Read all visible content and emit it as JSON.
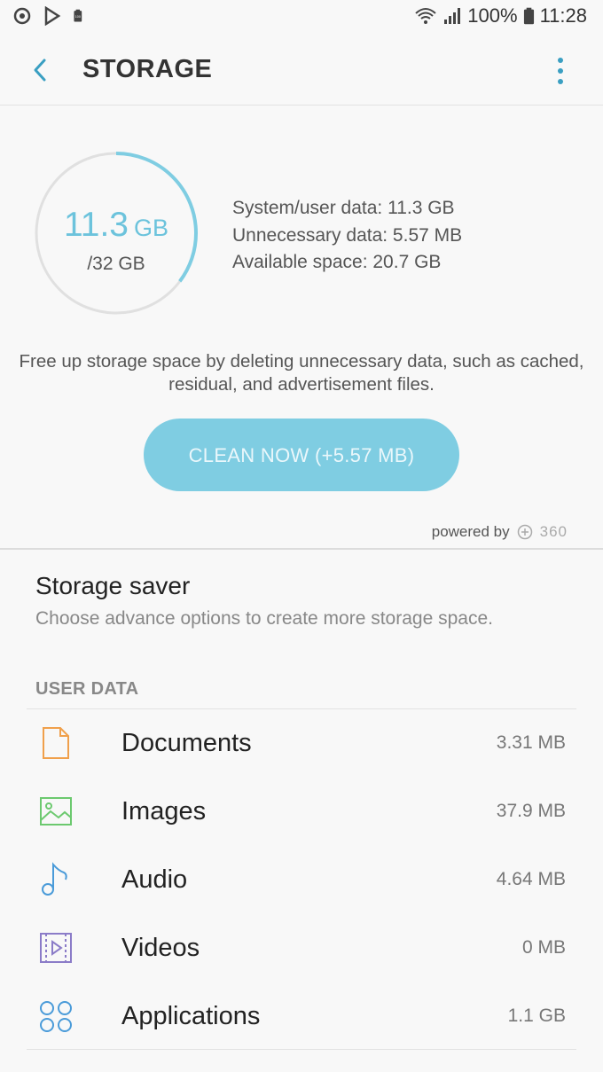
{
  "status_bar": {
    "battery_percent": "100%",
    "time": "11:28",
    "battery_icon_text": "100"
  },
  "header": {
    "title": "STORAGE"
  },
  "summary": {
    "used_value": "11.3",
    "used_unit": "GB",
    "total": "/32 GB",
    "used_fraction": 0.353,
    "accent_color": "#6cc3dc",
    "stats": [
      "System/user data: 11.3 GB",
      "Unnecessary data: 5.57 MB",
      "Available space: 20.7 GB"
    ],
    "description": "Free up storage space by deleting unnecessary data, such as cached, residual, and advertisement files.",
    "clean_button_label": "CLEAN NOW (+5.57 MB)",
    "powered_by": "powered by",
    "brand": "360"
  },
  "storage_saver": {
    "title": "Storage saver",
    "subtitle": "Choose advance options to create more storage space."
  },
  "user_data": {
    "heading": "USER DATA",
    "items": [
      {
        "label": "Documents",
        "size": "3.31 MB",
        "icon": "document-icon",
        "color": "#f0a04b"
      },
      {
        "label": "Images",
        "size": "37.9 MB",
        "icon": "image-icon",
        "color": "#6cc96f"
      },
      {
        "label": "Audio",
        "size": "4.64 MB",
        "icon": "music-note-icon",
        "color": "#4a9bd9"
      },
      {
        "label": "Videos",
        "size": "0 MB",
        "icon": "video-icon",
        "color": "#8b7cc8"
      },
      {
        "label": "Applications",
        "size": "1.1 GB",
        "icon": "apps-icon",
        "color": "#4a9bd9"
      }
    ]
  }
}
